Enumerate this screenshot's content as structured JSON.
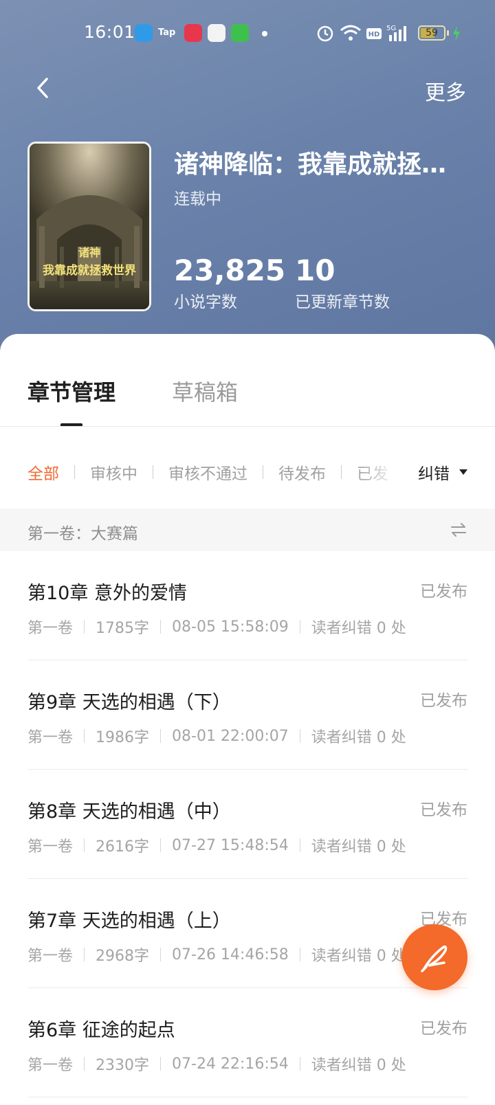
{
  "status_bar": {
    "time": "16:01",
    "tap_label": "Tap",
    "battery": "59"
  },
  "header": {
    "more_label": "更多"
  },
  "book": {
    "title": "诸神降临：我靠成就拯救...",
    "status": "连载中",
    "cover_text_line1": "诸神",
    "cover_text_line2": "我靠成就拯救世界",
    "stats": [
      {
        "value": "23,825",
        "label": "小说字数"
      },
      {
        "value": "10",
        "label": "已更新章节数"
      }
    ]
  },
  "tabs": [
    {
      "label": "章节管理",
      "active": true
    },
    {
      "label": "草稿箱",
      "active": false
    }
  ],
  "filters": {
    "items": [
      "全部",
      "审核中",
      "审核不通过",
      "待发布",
      "已发"
    ],
    "selected": "全部",
    "correction_label": "纠错"
  },
  "volume": {
    "label": "第一卷：大赛篇"
  },
  "chapters": [
    {
      "title": "第10章 意外的爱情",
      "status": "已发布",
      "volume": "第一卷",
      "words": "1785字",
      "time": "08-05 15:58:09",
      "corrections": "读者纠错 0 处"
    },
    {
      "title": "第9章 天选的相遇（下）",
      "status": "已发布",
      "volume": "第一卷",
      "words": "1986字",
      "time": "08-01 22:00:07",
      "corrections": "读者纠错 0 处"
    },
    {
      "title": "第8章 天选的相遇（中）",
      "status": "已发布",
      "volume": "第一卷",
      "words": "2616字",
      "time": "07-27 15:48:54",
      "corrections": "读者纠错 0 处"
    },
    {
      "title": "第7章 天选的相遇（上）",
      "status": "已发布",
      "volume": "第一卷",
      "words": "2968字",
      "time": "07-26 14:46:58",
      "corrections": "读者纠错 0 处"
    },
    {
      "title": "第6章 征途的起点",
      "status": "已发布",
      "volume": "第一卷",
      "words": "2330字",
      "time": "07-24 22:16:54",
      "corrections": "读者纠错 0 处"
    }
  ],
  "colors": {
    "accent": "#f26a32",
    "header_bg": "#6b83ab"
  }
}
